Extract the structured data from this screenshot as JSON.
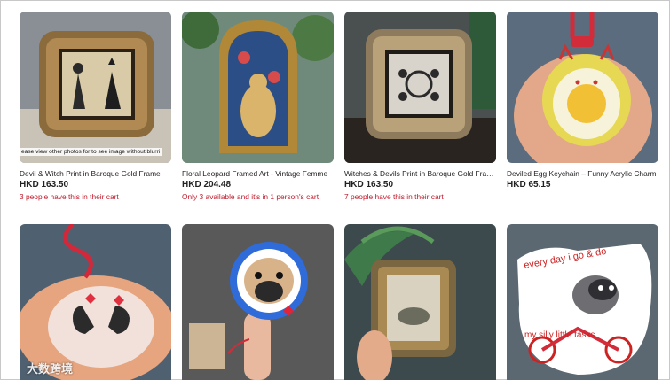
{
  "listings": [
    {
      "title": "Devil & Witch Print in Baroque Gold Frame",
      "price": "HKD 163.50",
      "note": "3 people have this in their cart",
      "overlay": "ease view other photos for to see image without blurri"
    },
    {
      "title": "Floral Leopard Framed Art - Vintage Femme",
      "price": "HKD 204.48",
      "note": "Only 3 available and it's in 1 person's cart"
    },
    {
      "title": "Witches & Devils Print in Baroque Gold Frame",
      "price": "HKD 163.50",
      "note": "7 people have this in their cart"
    },
    {
      "title": "Deviled Egg Keychain – Funny Acrylic Charm",
      "price": "HKD 65.15",
      "note": ""
    }
  ],
  "row2": {
    "raccoon_text": "every day i go & do my silly little tasks",
    "watermark": "大数跨境"
  }
}
